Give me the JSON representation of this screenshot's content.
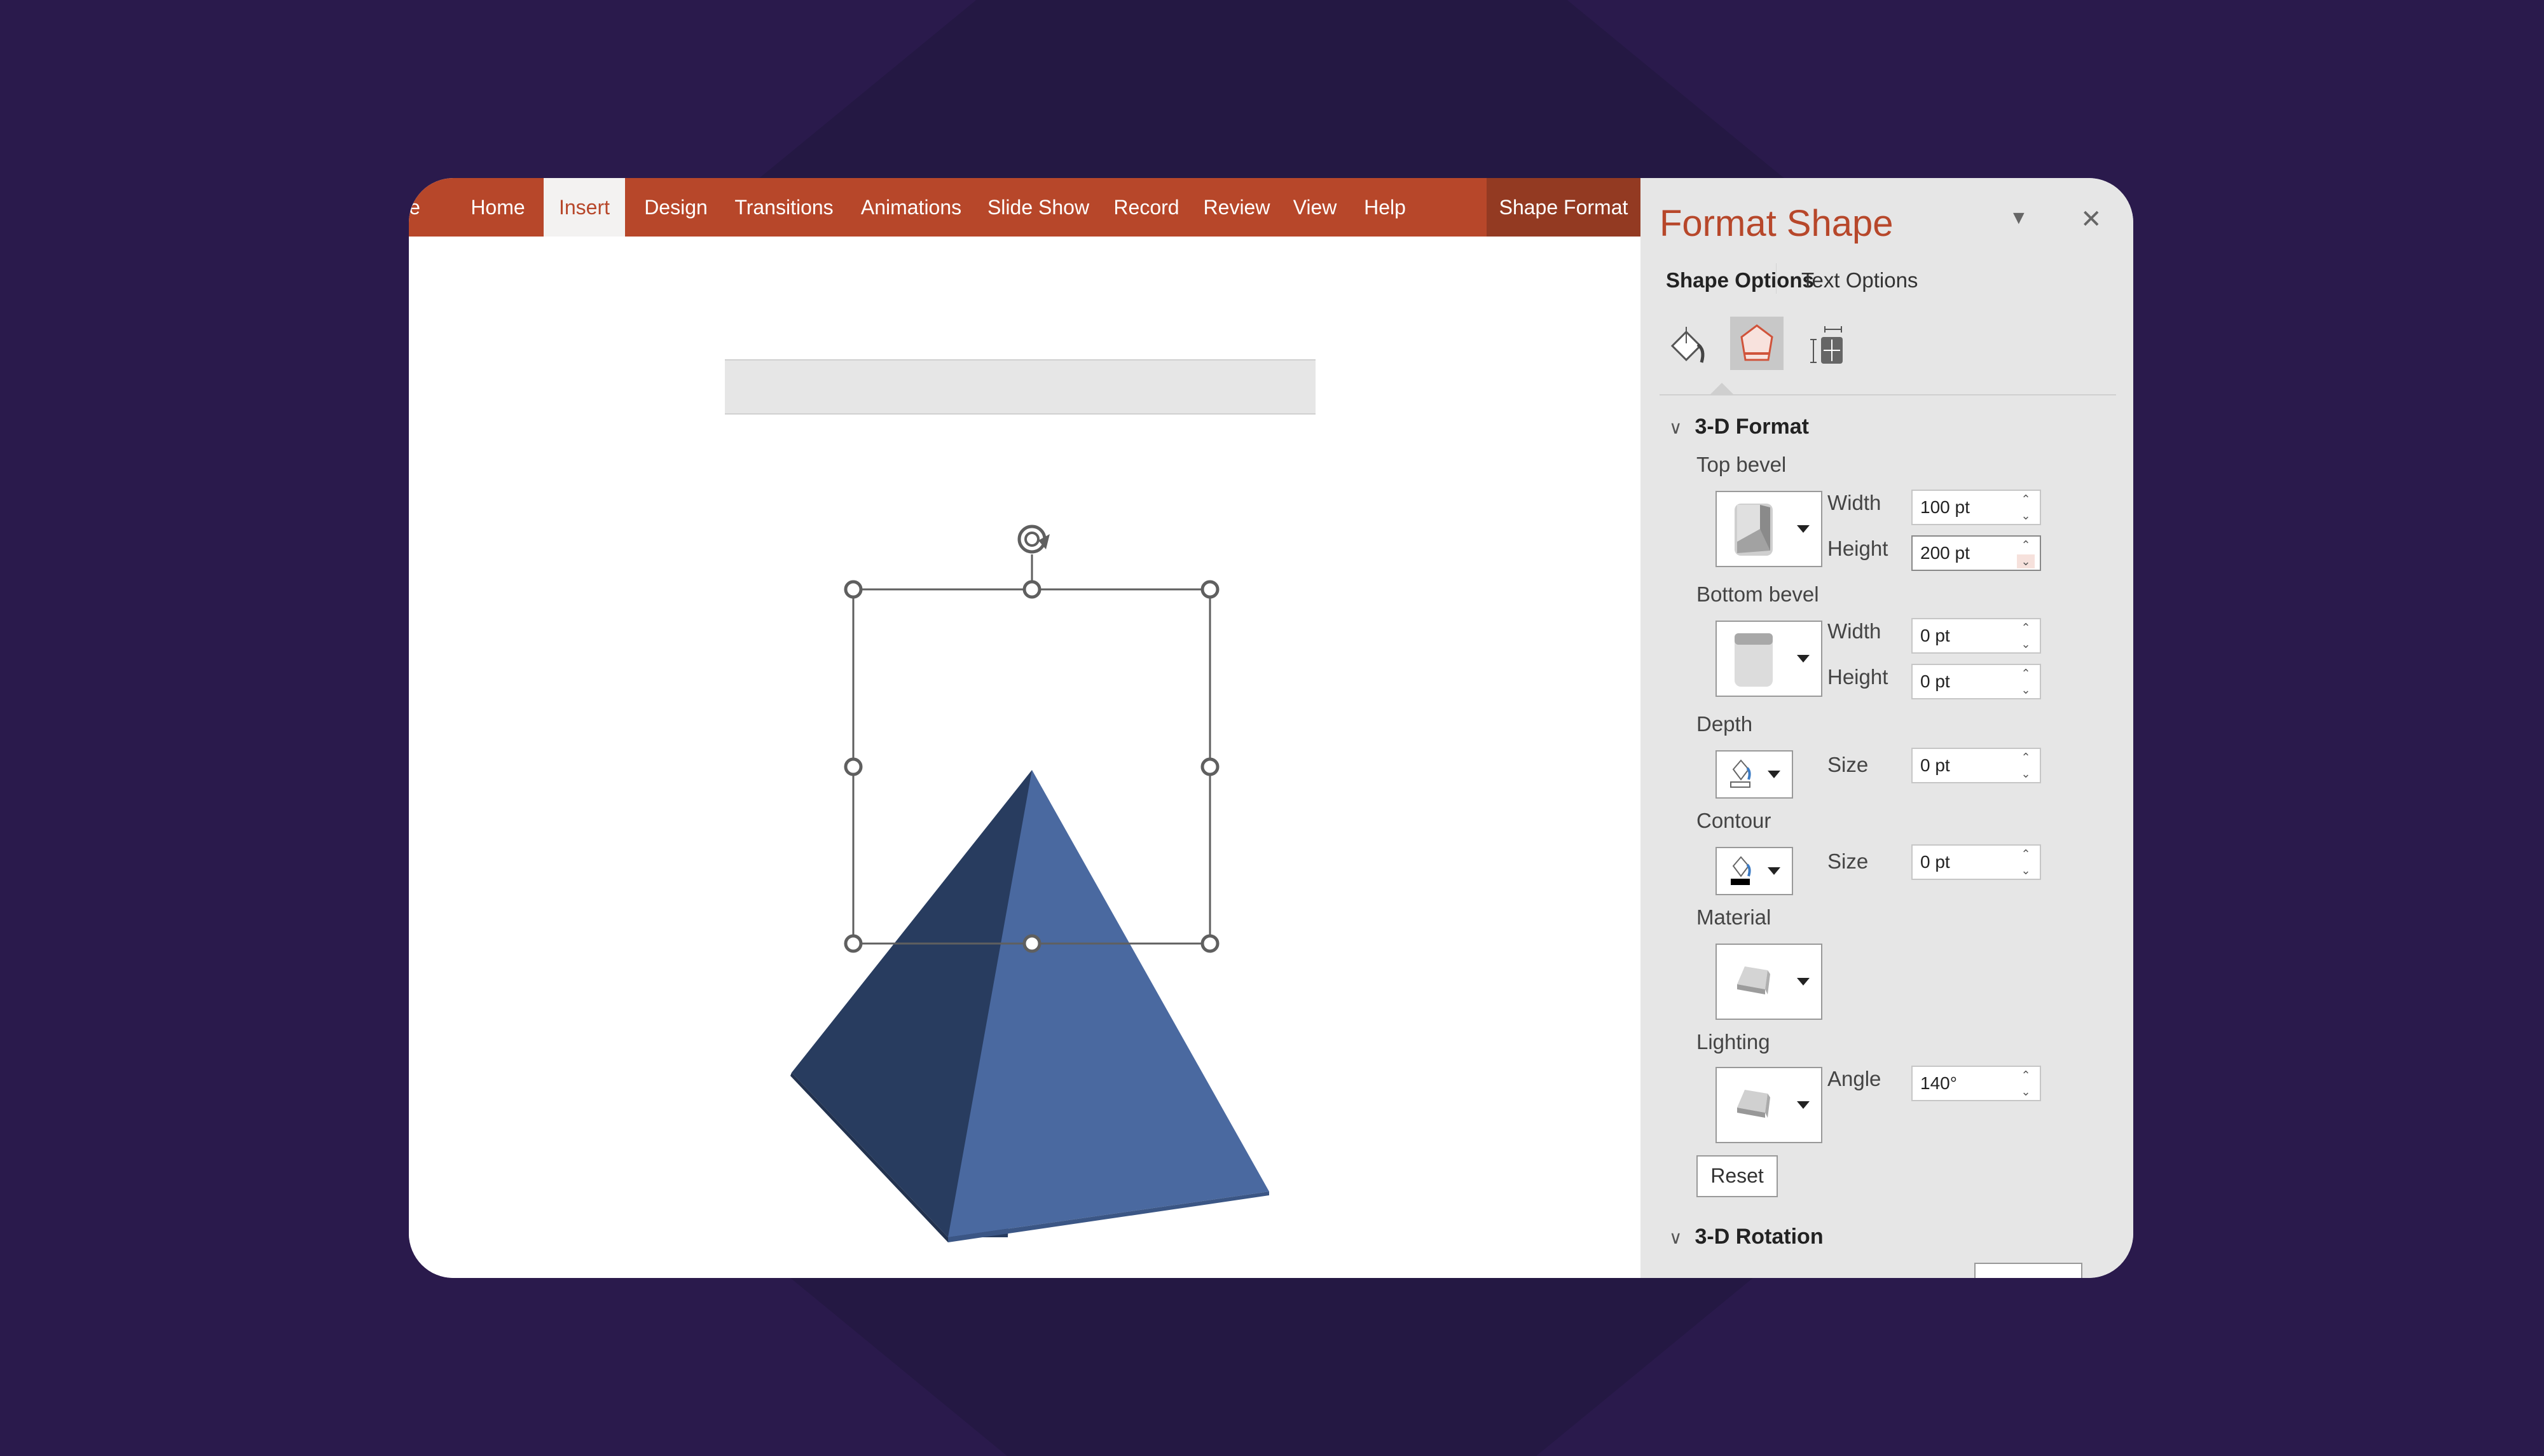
{
  "ribbon": {
    "tabs": [
      {
        "label": "e"
      },
      {
        "label": "Home"
      },
      {
        "label": "Insert",
        "active": true
      },
      {
        "label": "Design"
      },
      {
        "label": "Transitions"
      },
      {
        "label": "Animations"
      },
      {
        "label": "Slide Show"
      },
      {
        "label": "Record"
      },
      {
        "label": "Review"
      },
      {
        "label": "View"
      },
      {
        "label": "Help"
      },
      {
        "label": "Shape Format",
        "contextual": true
      }
    ]
  },
  "slide": {
    "shape": "3-D pyramid",
    "colors": {
      "left_face": "#283c5f",
      "right_face": "#4a69a0",
      "base_edge": "#3e5a8c"
    }
  },
  "format_panel": {
    "title": "Format Shape",
    "menu_icon": "dropdown-triangle",
    "close_icon": "close-x",
    "option_tabs": [
      {
        "label": "Shape Options",
        "active": true
      },
      {
        "label": "Text Options",
        "active": false
      }
    ],
    "category_icons": [
      {
        "name": "fill-line",
        "active": false
      },
      {
        "name": "effects",
        "active": true
      },
      {
        "name": "size-properties",
        "active": false
      }
    ],
    "section_3d_format": {
      "title": "3-D Format",
      "top_bevel": {
        "label": "Top bevel",
        "width_label": "Width",
        "width": "100 pt",
        "height_label": "Height",
        "height": "200 pt"
      },
      "bottom_bevel": {
        "label": "Bottom bevel",
        "width_label": "Width",
        "width": "0 pt",
        "height_label": "Height",
        "height": "0 pt"
      },
      "depth": {
        "label": "Depth",
        "size_label": "Size",
        "size": "0 pt"
      },
      "contour": {
        "label": "Contour",
        "size_label": "Size",
        "size": "0 pt"
      },
      "material": {
        "label": "Material"
      },
      "lighting": {
        "label": "Lighting",
        "angle_label": "Angle",
        "angle": "140°"
      },
      "reset_label": "Reset"
    },
    "section_3d_rotation": {
      "title": "3-D Rotation"
    }
  },
  "colors": {
    "accent": "#b7472a",
    "contextual_tab": "#933a22",
    "background": "#2a1a4c"
  }
}
